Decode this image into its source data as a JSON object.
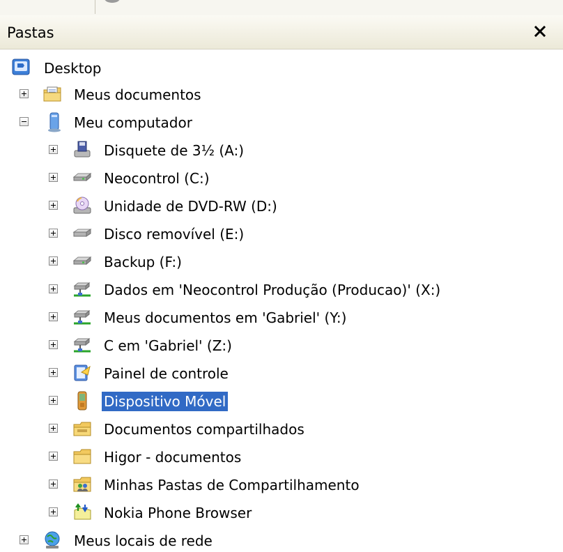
{
  "pane": {
    "title": "Pastas",
    "close_label": "×"
  },
  "tree": {
    "root": {
      "label": "Desktop",
      "icon": "desktop-icon"
    },
    "meus_documentos": {
      "label": "Meus documentos",
      "icon": "documents-folder-icon",
      "state": "collapsed"
    },
    "meu_computador": {
      "label": "Meu computador",
      "icon": "computer-icon",
      "state": "expanded"
    },
    "children": [
      {
        "label": "Disquete de 3½ (A:)",
        "icon": "floppy-drive-icon"
      },
      {
        "label": "Neocontrol (C:)",
        "icon": "hard-drive-icon"
      },
      {
        "label": "Unidade de DVD-RW (D:)",
        "icon": "dvd-drive-icon"
      },
      {
        "label": "Disco removível (E:)",
        "icon": "removable-disk-icon"
      },
      {
        "label": "Backup (F:)",
        "icon": "hard-drive-icon"
      },
      {
        "label": "Dados em 'Neocontrol Produção (Producao)' (X:)",
        "icon": "network-drive-icon"
      },
      {
        "label": "Meus documentos em 'Gabriel' (Y:)",
        "icon": "network-drive-icon"
      },
      {
        "label": "C em 'Gabriel' (Z:)",
        "icon": "network-drive-icon"
      },
      {
        "label": "Painel de controle",
        "icon": "control-panel-icon"
      },
      {
        "label": "Dispositivo Móvel",
        "icon": "mobile-device-icon",
        "selected": true
      },
      {
        "label": "Documentos compartilhados",
        "icon": "shared-folder-icon"
      },
      {
        "label": "Higor - documentos",
        "icon": "folder-icon"
      },
      {
        "label": "Minhas Pastas de Compartilhamento",
        "icon": "sharing-folder-icon"
      },
      {
        "label": "Nokia Phone Browser",
        "icon": "phone-browser-icon"
      }
    ],
    "meus_locais_de_rede": {
      "label": "Meus locais de rede",
      "icon": "network-places-icon",
      "state": "collapsed"
    }
  },
  "colors": {
    "selection": "#316ac5",
    "header_bg": "#ece9d8"
  }
}
